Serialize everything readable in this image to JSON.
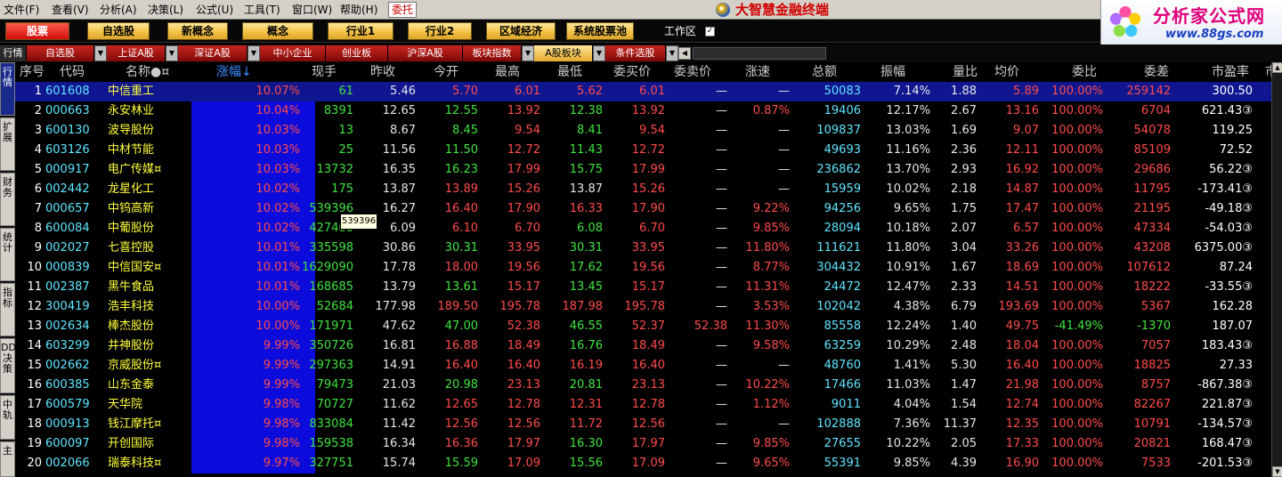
{
  "menu": [
    "文件(F)",
    "查看(V)",
    "分析(A)",
    "决策(L)",
    "公式(U)",
    "工具(T)",
    "窗口(W)",
    "帮助(H)"
  ],
  "menu_mark": "委托",
  "app_title": "大智慧金融终端",
  "toolbar": {
    "buttons": [
      "股票",
      "自选股",
      "新概念",
      "概念",
      "行业1",
      "行业2",
      "区域经济",
      "系统股票池"
    ],
    "active_index": 0,
    "workarea_label": "工作区",
    "workarea_checked": "✓"
  },
  "brand": {
    "name": "分析家公式网",
    "url": "www.88gs.com"
  },
  "tabs": {
    "first": "行情",
    "items": [
      "自选股",
      "上证A股",
      "深证A股",
      "中小企业",
      "创业板",
      "沪深A股",
      "板块指数",
      "A股板块",
      "条件选股"
    ],
    "active_index": 6
  },
  "sidebar": [
    "行情",
    "扩展",
    "财务",
    "统计",
    "指标",
    "DDE决策",
    "中轨",
    "主"
  ],
  "header": [
    "序号",
    "代码",
    "名称●¤",
    "涨幅↓",
    "现手",
    "昨收",
    "今开",
    "最高",
    "最低",
    "委买价",
    "委卖价",
    "涨速",
    "总额",
    "振幅",
    "量比",
    "均价",
    "委比",
    "委差",
    "市盈率",
    "市"
  ],
  "tooltip": "539396",
  "colors": {
    "up": "#ff4b4b",
    "down": "#3fe33f",
    "selected": "#0f168f",
    "sorted_band": "#0b0bdb",
    "header_sorted": "#3b8cff"
  },
  "rows": [
    [
      "1",
      "601608",
      "中信重工",
      "10.07%",
      "61",
      "5.46",
      "5.70",
      "6.01",
      "5.62",
      "6.01",
      "—",
      "—",
      "50083",
      "7.14%",
      "1.88",
      "5.89",
      "100.00%",
      "259142",
      "300.50"
    ],
    [
      "2",
      "000663",
      "永安林业",
      "10.04%",
      "8391",
      "12.65",
      "12.55",
      "13.92",
      "12.38",
      "13.92",
      "—",
      "0.87%",
      "19406",
      "12.17%",
      "2.67",
      "13.16",
      "100.00%",
      "6704",
      "621.43③"
    ],
    [
      "3",
      "600130",
      "波导股份",
      "10.03%",
      "13",
      "8.67",
      "8.45",
      "9.54",
      "8.41",
      "9.54",
      "—",
      "—",
      "109837",
      "13.03%",
      "1.69",
      "9.07",
      "100.00%",
      "54078",
      "119.25"
    ],
    [
      "4",
      "603126",
      "中材节能",
      "10.03%",
      "25",
      "11.56",
      "11.50",
      "12.72",
      "11.43",
      "12.72",
      "—",
      "—",
      "49693",
      "11.16%",
      "2.36",
      "12.11",
      "100.00%",
      "85109",
      "72.52"
    ],
    [
      "5",
      "000917",
      "电广传媒¤",
      "10.03%",
      "13732",
      "16.35",
      "16.23",
      "17.99",
      "15.75",
      "17.99",
      "—",
      "—",
      "236862",
      "13.70%",
      "2.93",
      "16.92",
      "100.00%",
      "29686",
      "56.22③"
    ],
    [
      "6",
      "002442",
      "龙星化工",
      "10.02%",
      "175",
      "13.87",
      "13.89",
      "15.26",
      "13.87",
      "15.26",
      "—",
      "—",
      "15959",
      "10.02%",
      "2.18",
      "14.87",
      "100.00%",
      "11795",
      "-173.41③"
    ],
    [
      "7",
      "000657",
      "中钨高新",
      "10.02%",
      "539396",
      "16.27",
      "16.40",
      "17.90",
      "16.33",
      "17.90",
      "—",
      "9.22%",
      "94256",
      "9.65%",
      "1.75",
      "17.47",
      "100.00%",
      "21195",
      "-49.18③"
    ],
    [
      "8",
      "600084",
      "中葡股份",
      "10.02%",
      "427400",
      "6.09",
      "6.10",
      "6.70",
      "6.08",
      "6.70",
      "—",
      "9.85%",
      "28094",
      "10.18%",
      "2.07",
      "6.57",
      "100.00%",
      "47334",
      "-54.03③"
    ],
    [
      "9",
      "002027",
      "七喜控股",
      "10.01%",
      "335598",
      "30.86",
      "30.31",
      "33.95",
      "30.31",
      "33.95",
      "—",
      "11.80%",
      "111621",
      "11.80%",
      "3.04",
      "33.26",
      "100.00%",
      "43208",
      "6375.00③"
    ],
    [
      "10",
      "000839",
      "中信国安¤",
      "10.01%",
      "1629090",
      "17.78",
      "18.00",
      "19.56",
      "17.62",
      "19.56",
      "—",
      "8.77%",
      "304432",
      "10.91%",
      "1.67",
      "18.69",
      "100.00%",
      "107612",
      "87.24"
    ],
    [
      "11",
      "002387",
      "黑牛食品",
      "10.01%",
      "168685",
      "13.79",
      "13.61",
      "15.17",
      "13.45",
      "15.17",
      "—",
      "11.31%",
      "24472",
      "12.47%",
      "2.33",
      "14.51",
      "100.00%",
      "18222",
      "-33.55③"
    ],
    [
      "12",
      "300419",
      "浩丰科技",
      "10.00%",
      "52684",
      "177.98",
      "189.50",
      "195.78",
      "187.98",
      "195.78",
      "—",
      "3.53%",
      "102042",
      "4.38%",
      "6.79",
      "193.69",
      "100.00%",
      "5367",
      "162.28"
    ],
    [
      "13",
      "002634",
      "棒杰股份",
      "10.00%",
      "171971",
      "47.62",
      "47.00",
      "52.38",
      "46.55",
      "52.37",
      "52.38",
      "11.30%",
      "85558",
      "12.24%",
      "1.40",
      "49.75",
      "-41.49%",
      "-1370",
      "187.07"
    ],
    [
      "14",
      "603299",
      "井神股份",
      "9.99%",
      "350726",
      "16.81",
      "16.88",
      "18.49",
      "16.76",
      "18.49",
      "—",
      "9.58%",
      "63259",
      "10.29%",
      "2.48",
      "18.04",
      "100.00%",
      "7057",
      "183.43③"
    ],
    [
      "15",
      "002662",
      "京威股份¤",
      "9.99%",
      "297363",
      "14.91",
      "16.40",
      "16.40",
      "16.19",
      "16.40",
      "—",
      "—",
      "48760",
      "1.41%",
      "5.30",
      "16.40",
      "100.00%",
      "18825",
      "27.33"
    ],
    [
      "16",
      "600385",
      "山东金泰",
      "9.99%",
      "79473",
      "21.03",
      "20.98",
      "23.13",
      "20.81",
      "23.13",
      "—",
      "10.22%",
      "17466",
      "11.03%",
      "1.47",
      "21.98",
      "100.00%",
      "8757",
      "-867.38③"
    ],
    [
      "17",
      "600579",
      "天华院",
      "9.98%",
      "70727",
      "11.62",
      "12.65",
      "12.78",
      "12.31",
      "12.78",
      "—",
      "1.12%",
      "9011",
      "4.04%",
      "1.54",
      "12.74",
      "100.00%",
      "82267",
      "221.87③"
    ],
    [
      "18",
      "000913",
      "钱江摩托¤",
      "9.98%",
      "833084",
      "11.42",
      "12.56",
      "12.56",
      "11.72",
      "12.56",
      "—",
      "—",
      "102888",
      "7.36%",
      "11.37",
      "12.35",
      "100.00%",
      "10791",
      "-134.57③"
    ],
    [
      "19",
      "600097",
      "开创国际",
      "9.98%",
      "159538",
      "16.34",
      "16.36",
      "17.97",
      "16.30",
      "17.97",
      "—",
      "9.85%",
      "27655",
      "10.22%",
      "2.05",
      "17.33",
      "100.00%",
      "20821",
      "168.47③"
    ],
    [
      "20",
      "002066",
      "瑞泰科技¤",
      "9.97%",
      "327751",
      "15.74",
      "15.59",
      "17.09",
      "15.56",
      "17.09",
      "—",
      "9.65%",
      "55391",
      "9.85%",
      "4.39",
      "16.90",
      "100.00%",
      "7533",
      "-201.53③"
    ]
  ]
}
